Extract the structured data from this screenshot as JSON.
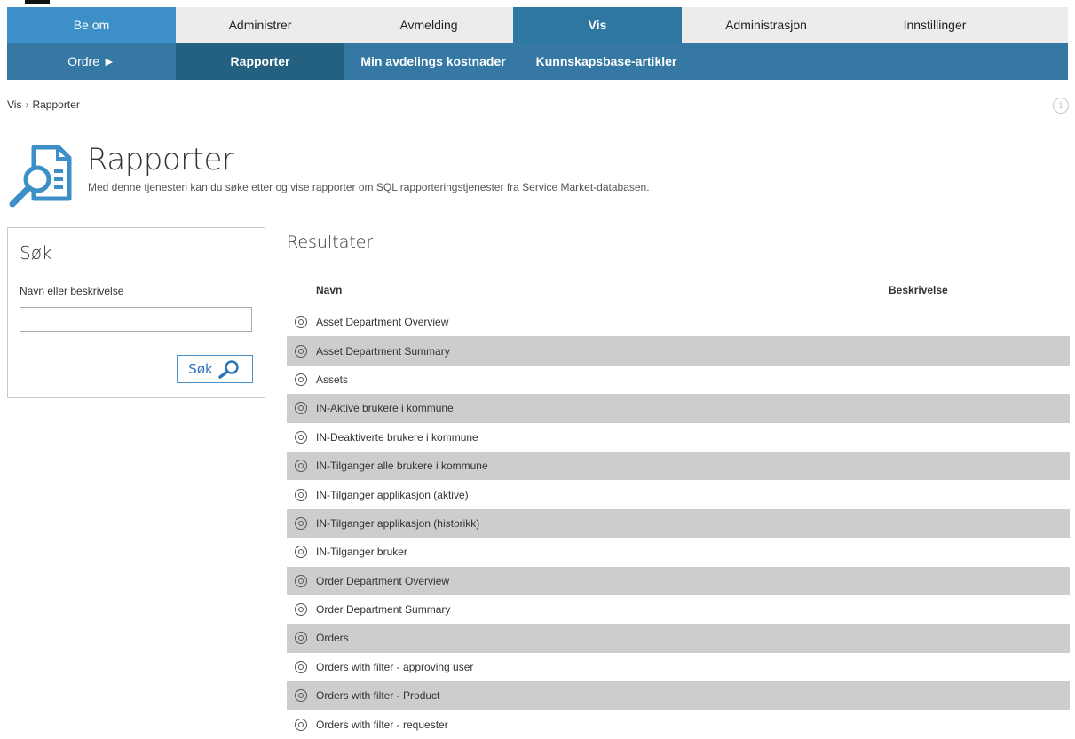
{
  "top_tabs": [
    "Be om",
    "Administrer",
    "Avmelding",
    "Vis",
    "Administrasjon",
    "Innstillinger"
  ],
  "sub_tabs": [
    "Ordre ►",
    "Rapporter",
    "Min avdelings kostnader",
    "Kunnskapsbase-artikler"
  ],
  "breadcrumb": {
    "root": "Vis",
    "separator": "›",
    "current": "Rapporter"
  },
  "page": {
    "title": "Rapporter",
    "description": "Med denne tjenesten kan du søke etter og vise rapporter om SQL rapporteringstjenester fra Service Market-databasen."
  },
  "search": {
    "title": "Søk",
    "label": "Navn eller beskrivelse",
    "value": "",
    "button_label": "Søk"
  },
  "results": {
    "title": "Resultater",
    "col_name": "Navn",
    "col_description": "Beskrivelse",
    "rows": [
      "Asset Department Overview",
      "Asset Department Summary",
      "Assets",
      "IN-Aktive brukere i kommune",
      "IN-Deaktiverte brukere i kommune",
      "IN-Tilganger alle brukere i kommune",
      "IN-Tilganger applikasjon (aktive)",
      "IN-Tilganger applikasjon (historikk)",
      "IN-Tilganger bruker",
      "Order Department Overview",
      "Order Department Summary",
      "Orders",
      "Orders with filter - approving user",
      "Orders with filter - Product",
      "Orders with filter - requester"
    ]
  },
  "colors": {
    "accent": "#3d8fc7",
    "selected_tab": "#2e77a0",
    "subnav": "#3478a3",
    "row_alt": "#cdcdcd"
  }
}
